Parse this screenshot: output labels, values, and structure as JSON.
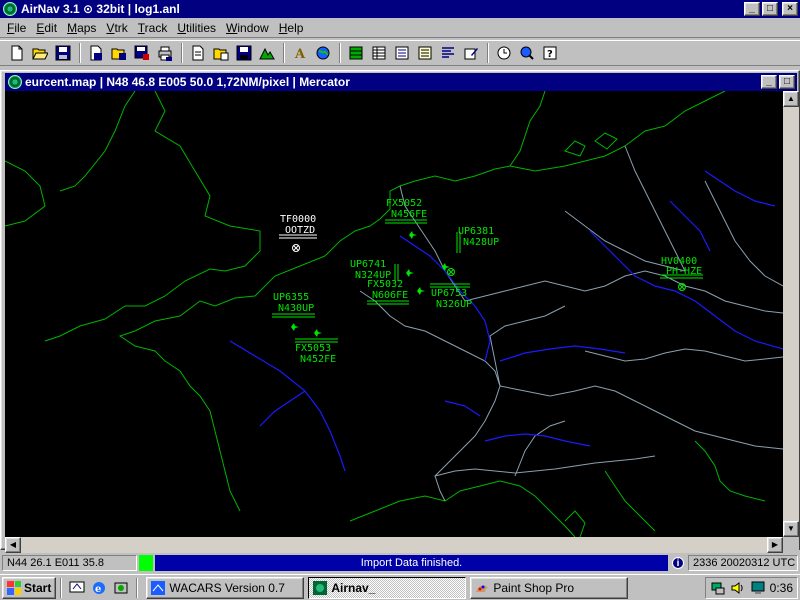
{
  "app": {
    "title": "AirNav 3.1  ⊙ 32bit | log1.anl",
    "window_buttons": {
      "minimize": "_",
      "maximize": "□",
      "close": "×"
    }
  },
  "menu": [
    "File",
    "Edit",
    "Maps",
    "Vtrk",
    "Track",
    "Utilities",
    "Window",
    "Help"
  ],
  "toolbar": {
    "groups": [
      [
        "new-icon",
        "open-icon",
        "save-icon"
      ],
      [
        "new-log-icon",
        "open-log-icon",
        "save-log-icon",
        "print-icon"
      ],
      [
        "new-map-icon",
        "print-map-icon",
        "save-map-icon",
        "map-tool-icon"
      ],
      [
        "label-tool-icon",
        "globe-icon"
      ],
      [
        "grid-green-icon",
        "table-icon",
        "list-icon",
        "list-detail-icon",
        "text-list-icon",
        "edit-list-icon"
      ],
      [
        "clock-icon",
        "search-globe-icon",
        "help-icon"
      ]
    ]
  },
  "map_window": {
    "title": "eurcent.map | N48 46.8 E005 50.0 1,72NM/pixel | Mercator",
    "background": "#000000",
    "coast_color": "#00b400",
    "river_color": "#1a1aff",
    "border_color": "#8aa0b0",
    "aircraft": [
      {
        "callsign": "TF0000",
        "reg": "OOTZD",
        "color": "#ffffff",
        "symbol": "target"
      },
      {
        "callsign": "FX5052",
        "reg": "N456FE",
        "color": "#00e600",
        "symbol": "plane"
      },
      {
        "callsign": "UP6381",
        "reg": "N428UP",
        "color": "#00e600",
        "symbol": "plane"
      },
      {
        "callsign": "UP6741",
        "reg": "N324UP",
        "color": "#00e600",
        "symbol": "plane"
      },
      {
        "callsign": "FX5032",
        "reg": "N606FE",
        "color": "#00e600",
        "symbol": "plane"
      },
      {
        "callsign": "UP6753",
        "reg": "N326UP",
        "color": "#00e600",
        "symbol": "target"
      },
      {
        "callsign": "HV0400",
        "reg": "PH-HZE",
        "color": "#00e600",
        "symbol": "target"
      },
      {
        "callsign": "UP6355",
        "reg": "N430UP",
        "color": "#00e600",
        "symbol": "plane"
      },
      {
        "callsign": "FX5053",
        "reg": "N452FE",
        "color": "#00e600",
        "symbol": "plane"
      }
    ]
  },
  "status": {
    "position": "N44 26.1   E011 35.8",
    "message": "Import Data finished.",
    "info_icon": "i",
    "time": "2336 20020312 UTC"
  },
  "taskbar": {
    "start_label": "Start",
    "quick_launch": [
      "desktop-icon",
      "ie-icon",
      "channels-icon"
    ],
    "tasks": [
      {
        "label": "WACARS Version 0.7",
        "icon": "wacars-icon",
        "active": false
      },
      {
        "label": "Airnav_",
        "icon": "airnav-icon",
        "active": true
      },
      {
        "label": "Paint Shop Pro",
        "icon": "paintshop-icon",
        "active": false
      }
    ],
    "clock": "0:36"
  }
}
